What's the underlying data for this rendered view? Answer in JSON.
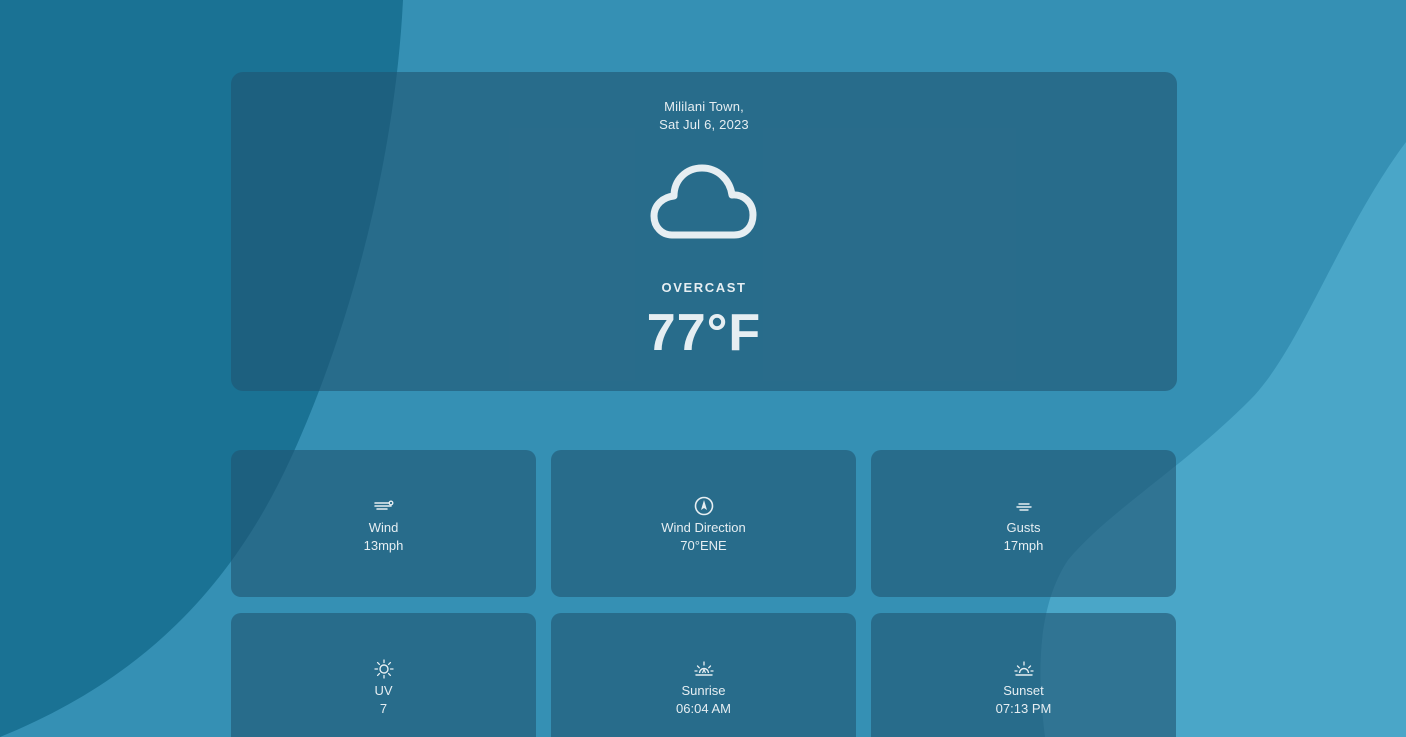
{
  "location": {
    "city": "Mililani Town,",
    "date": "Sat Jul 6, 2023"
  },
  "current": {
    "icon": "cloud-icon",
    "condition": "OVERCAST",
    "temperature": "77°F"
  },
  "stats": [
    {
      "icon": "wind-icon",
      "label": "Wind",
      "value": "13mph"
    },
    {
      "icon": "compass-icon",
      "label": "Wind Direction",
      "value": "70°ENE"
    },
    {
      "icon": "gusts-icon",
      "label": "Gusts",
      "value": "17mph"
    },
    {
      "icon": "sun-icon",
      "label": "UV",
      "value": "7"
    },
    {
      "icon": "sunrise-icon",
      "label": "Sunrise",
      "value": "06:04 AM"
    },
    {
      "icon": "sunset-icon",
      "label": "Sunset",
      "value": "07:13 PM"
    }
  ],
  "colors": {
    "background": "#3590b4",
    "dark_shape": "#1a7294",
    "light_shape": "#4aa6c8",
    "card": "#2b6e8c",
    "text": "#e6eef2"
  }
}
